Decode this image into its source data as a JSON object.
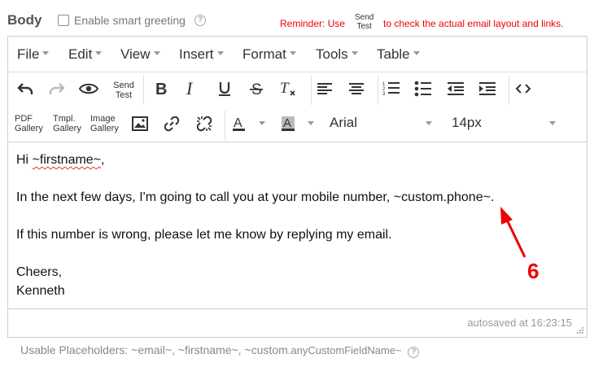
{
  "header": {
    "body_label": "Body",
    "smart_greeting_label": "Enable smart greeting",
    "smart_greeting_checked": false,
    "help_glyph": "?",
    "reminder_prefix": "Reminder: Use",
    "reminder_send_line1": "Send",
    "reminder_send_line2": "Test",
    "reminder_suffix": "to check the actual email layout and links."
  },
  "menubar": {
    "items": [
      {
        "label": "File"
      },
      {
        "label": "Edit"
      },
      {
        "label": "View"
      },
      {
        "label": "Insert"
      },
      {
        "label": "Format"
      },
      {
        "label": "Tools"
      },
      {
        "label": "Table"
      }
    ]
  },
  "toolbar": {
    "send_test_line1": "Send",
    "send_test_line2": "Test",
    "pdf_gallery_line1": "PDF",
    "pdf_gallery_line2": "Gallery",
    "tmpl_gallery_line1": "Tmpl.",
    "tmpl_gallery_line2": "Gallery",
    "image_gallery_line1": "Image",
    "image_gallery_line2": "Gallery",
    "font_family_value": "Arial",
    "font_size_value": "14px",
    "icons": [
      "undo-icon",
      "redo-icon",
      "preview-eye-icon",
      "bold-icon",
      "italic-icon",
      "underline-icon",
      "strikethrough-icon",
      "clear-format-icon",
      "align-left-icon",
      "align-center-icon",
      "numbered-list-icon",
      "bullet-list-icon",
      "outdent-icon",
      "indent-icon",
      "source-code-icon",
      "image-icon",
      "link-icon",
      "unlink-icon",
      "text-color-icon",
      "background-color-icon"
    ]
  },
  "content": {
    "line1_prefix": "Hi ",
    "line1_placeholder": "~firstname~",
    "line1_suffix": ",",
    "line2": "In the next few days, I'm going to call you at your mobile number, ~custom.phone~.",
    "line3": "If this number is wrong, please let me know by replying my email.",
    "line4": "Cheers,",
    "line5": "Kenneth"
  },
  "statusbar": {
    "autosaved": "autosaved at 16:23:15"
  },
  "footer": {
    "placeholders_prefix": "Usable Placeholders: ~email~, ~firstname~, ~custom",
    "placeholders_small": ".anyCustomFieldName~"
  },
  "annotation": {
    "number": "6",
    "color": "#e00000"
  }
}
